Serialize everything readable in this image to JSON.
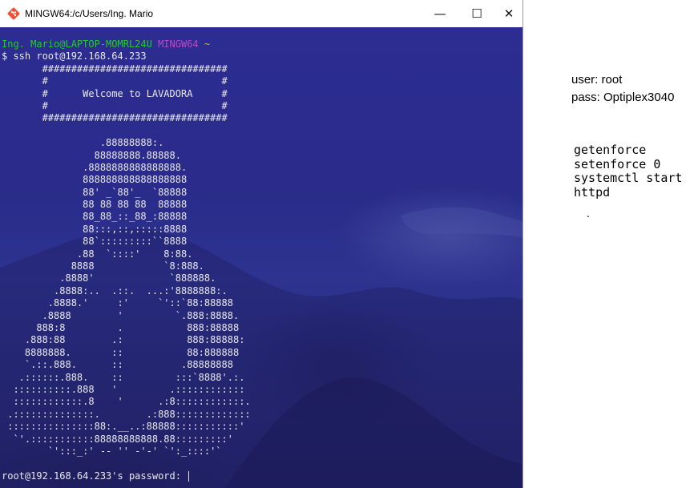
{
  "window": {
    "title": "MINGW64:/c/Users/Ing. Mario",
    "controls": {
      "minimize": "—",
      "maximize": "☐",
      "close": "✕"
    },
    "icon": "git-bash-icon",
    "accent_color": "#f05133"
  },
  "terminal": {
    "colors": {
      "user": "#1fd11f",
      "env": "#c347c3",
      "path": "#cdb63a",
      "text": "#e8e8ee"
    },
    "prompt_user": "Ing. Mario@LAPTOP-MOMRL24U",
    "prompt_env": "MINGW64",
    "prompt_path": "~",
    "command": "$ ssh root@192.168.64.233",
    "banner": [
      "       ################################",
      "       #                              #",
      "       #      Welcome to LAVADORA     #",
      "       #                              #",
      "       ################################"
    ],
    "ascii_art": [
      "",
      "                 .88888888:.",
      "                88888888.88888.",
      "              .8888888888888888.",
      "              888888888888888888",
      "              88' _`88'_  `88888",
      "              88 88 88 88  88888",
      "              88_88_::_88_:88888",
      "              88:::,::,:::::8888",
      "              88`:::::::::``8888",
      "             .88  `::::'    8:88.",
      "            8888            `8:888.",
      "          .8888'             `888888.",
      "         .8888:..  .::.  ...:'8888888:.",
      "        .8888.'     :'     `'::`88:88888",
      "       .8888        '         `.888:8888.",
      "      888:8         .           888:88888",
      "    .888:88        .:           888:88888:",
      "    8888888.       ::           88:888888",
      "    `.::.888.      ::          .88888888",
      "   .::::::.888.    ::         :::`8888'.:.",
      "  ::::::::::.888   '         .::::::::::::",
      "  ::::::::::::.8    '      .:8::::::::::::.",
      " .::::::::::::::.        .:888:::::::::::::",
      " :::::::::::::::88:.__..:88888:::::::::::'",
      "  `'.:::::::::::88888888888.88:::::::::'",
      "        `':::_:' -- '' -'-' `':_::::'`",
      ""
    ],
    "password_prompt": "root@192.168.64.233's password: "
  },
  "notes": {
    "user": "user: root",
    "pass": "pass: Optiplex3040",
    "commands": [
      "getenforce",
      "setenforce 0",
      "systemctl start",
      "httpd"
    ],
    "dot": "."
  }
}
